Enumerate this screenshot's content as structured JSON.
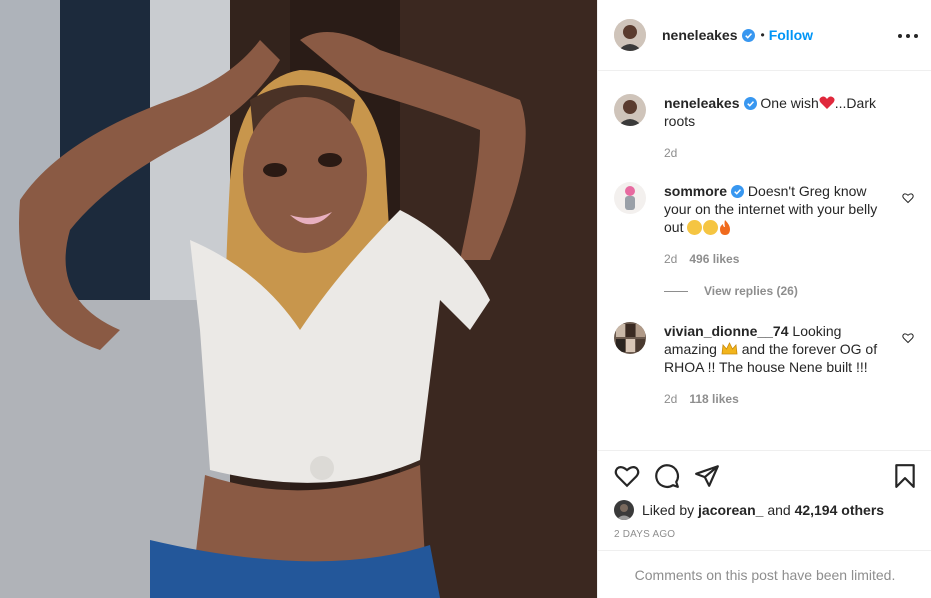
{
  "post_author": {
    "username": "neneleakes",
    "follow_label": "Follow",
    "separator": "•"
  },
  "caption": {
    "username": "neneleakes",
    "text_before_emoji": "One wish",
    "text_after_emoji": "...Dark roots",
    "time": "2d"
  },
  "comments": [
    {
      "username": "sommore",
      "text": "Doesn't Greg know your on the internet with your belly out",
      "time": "2d",
      "likes": "496 likes",
      "view_replies": "View replies (26)"
    },
    {
      "username": "vivian_dionne__74",
      "text_before_emoji": "Looking amazing",
      "text_after_emoji": "and the forever OG of RHOA !! The house Nene built !!!",
      "time": "2d",
      "likes": "118 likes"
    }
  ],
  "likes": {
    "prefix": "Liked by",
    "user": "jacorean_",
    "conjunction": "and",
    "others": "42,194 others"
  },
  "post_date": "2 DAYS AGO",
  "comments_limited": "Comments on this post have been limited.",
  "colors": {
    "accent": "#0095f6",
    "secondary_text": "#8e8e8e",
    "primary_text": "#262626",
    "border": "#efefef"
  }
}
